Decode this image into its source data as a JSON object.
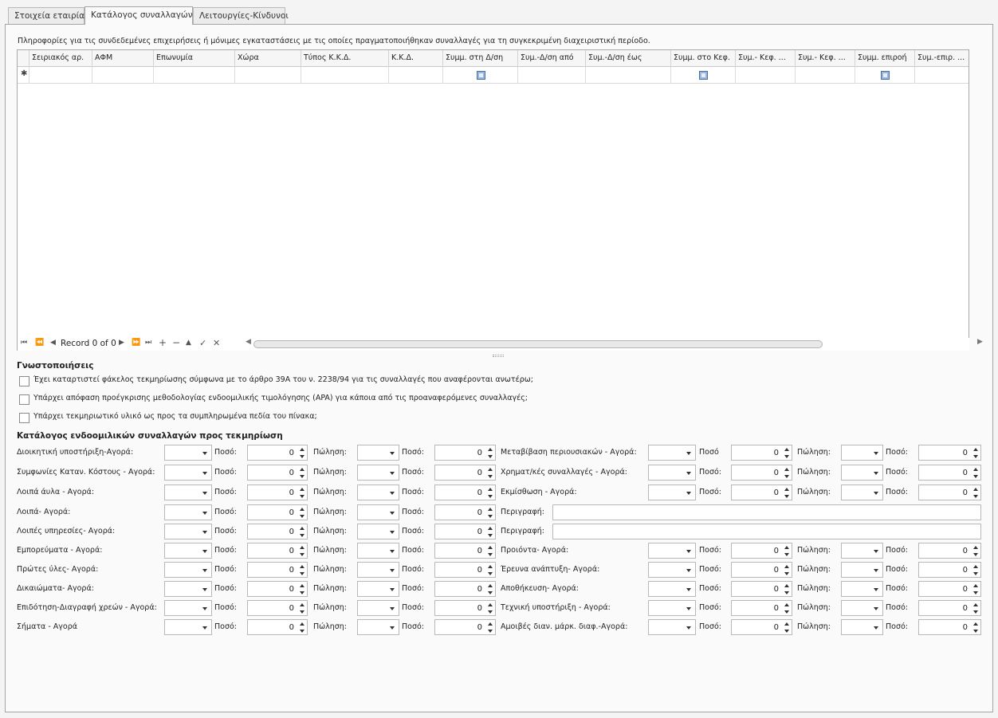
{
  "tabs": [
    {
      "label": "Στοιχεία εταιρίας",
      "active": false
    },
    {
      "label": "Κατάλογος συναλλαγών",
      "active": true
    },
    {
      "label": "Λειτουργίες-Κίνδυνοι",
      "active": false
    }
  ],
  "info_text": "Πληροφορίες για τις συνδεδεμένες επιχειρήσεις ή μόνιμες εγκαταστάσεις με τις οποίες πραγματοποιήθηκαν συναλλαγές για τη συγκεκριμένη διαχειριστική περίοδο.",
  "grid": {
    "columns": [
      {
        "label": "Σειριακός αρ.",
        "checkbox": false
      },
      {
        "label": "ΑΦΜ",
        "checkbox": false
      },
      {
        "label": "Επωνυμία",
        "checkbox": false
      },
      {
        "label": "Χώρα",
        "checkbox": false
      },
      {
        "label": "Τύπος Κ.Κ.Δ.",
        "checkbox": false
      },
      {
        "label": "Κ.Κ.Δ.",
        "checkbox": false
      },
      {
        "label": "Συμμ. στη Δ/ση",
        "checkbox": true
      },
      {
        "label": "Συμ.-Δ/ση από",
        "checkbox": false
      },
      {
        "label": "Συμ.-Δ/ση έως",
        "checkbox": false
      },
      {
        "label": "Συμμ. στο Κεφ.",
        "checkbox": true
      },
      {
        "label": "Συμ.- Κεφ. ...",
        "checkbox": false
      },
      {
        "label": "Συμ.- Κεφ. ...",
        "checkbox": false
      },
      {
        "label": "Συμμ. επιροή",
        "checkbox": true
      },
      {
        "label": "Συμ.-επιρ. ...",
        "checkbox": false
      }
    ],
    "new_row_marker": "✱",
    "navigator": {
      "record_text": "Record 0 of 0"
    }
  },
  "notices": {
    "title": "Γνωστοποιήσεις",
    "items": [
      {
        "label": "Έχει καταρτιστεί φάκελος τεκμηρίωσης σύμφωνα με το άρθρο 39Α του ν. 2238/94 για τις συναλλαγές που αναφέρονται ανωτέρω;",
        "checked": false
      },
      {
        "label": "Υπάρχει απόφαση προέγκρισης μεθοδολογίας ενδοομιλικής τιμολόγησης (APA) για κάποια από τις προαναφερόμενες συναλλαγές;",
        "checked": false
      },
      {
        "label": "Υπάρχει τεκμηριωτικό υλικό ως προς τα συμπληρωμένα πεδία του πίνακα;",
        "checked": false
      }
    ]
  },
  "transactions": {
    "title": "Κατάλογος ενδοομιλικών συναλλαγών προς τεκμηρίωση",
    "amount_label": "Ποσό:",
    "amount_label_plain": "Ποσό",
    "sale_label": "Πώληση:",
    "description_label": "Περιγραφή:",
    "rows": [
      {
        "left": "Διοικητική υποστήριξη-Αγορά:",
        "left_values": [
          0,
          0
        ],
        "right": "Μεταβίβαση περιουσιακών - Αγορά:",
        "right_type": "fields",
        "right_values": [
          0,
          0
        ],
        "right_amount_plain": true
      },
      {
        "left": "Συμφωνίες Καταν. Κόστους - Αγορά:",
        "left_values": [
          0,
          0
        ],
        "right": "Χρηματ/κές συναλλαγές - Αγορά:",
        "right_type": "fields",
        "right_values": [
          0,
          0
        ]
      },
      {
        "left": "Λοιπά άυλα - Αγορά:",
        "left_values": [
          0,
          0
        ],
        "right": "Εκμίσθωση - Αγορά:",
        "right_type": "fields",
        "right_values": [
          0,
          0
        ]
      },
      {
        "left": "Λοιπά- Αγορά:",
        "left_values": [
          0,
          0
        ],
        "right_type": "description"
      },
      {
        "left": "Λοιπές υπηρεσίες- Αγορά:",
        "left_values": [
          0,
          0
        ],
        "right_type": "description"
      },
      {
        "left": "Εμπορεύματα - Αγορά:",
        "left_values": [
          0,
          0
        ],
        "right": "Προιόντα- Αγορά:",
        "right_type": "fields",
        "right_values": [
          0,
          0
        ]
      },
      {
        "left": "Πρώτες ύλες- Αγορά:",
        "left_values": [
          0,
          0
        ],
        "right": "Έρευνα  ανάπτυξη- Αγορά:",
        "right_type": "fields",
        "right_values": [
          0,
          0
        ]
      },
      {
        "left": "Δικαιώματα- Αγορά:",
        "left_values": [
          0,
          0
        ],
        "right": "Αποθήκευση- Αγορά:",
        "right_type": "fields",
        "right_values": [
          0,
          0
        ]
      },
      {
        "left": "Επιδότηση-Διαγραφή χρεών - Αγορά:",
        "left_values": [
          0,
          0
        ],
        "right": "Τεχνική υποστήριξη - Αγορά:",
        "right_type": "fields",
        "right_values": [
          0,
          0
        ]
      },
      {
        "left": "Σήματα - Αγορά",
        "left_values": [
          0,
          0
        ],
        "right": "Αμοιβές διαν. μάρκ.  διαφ.-Αγορά:",
        "right_type": "fields",
        "right_values": [
          0,
          0
        ]
      }
    ]
  }
}
